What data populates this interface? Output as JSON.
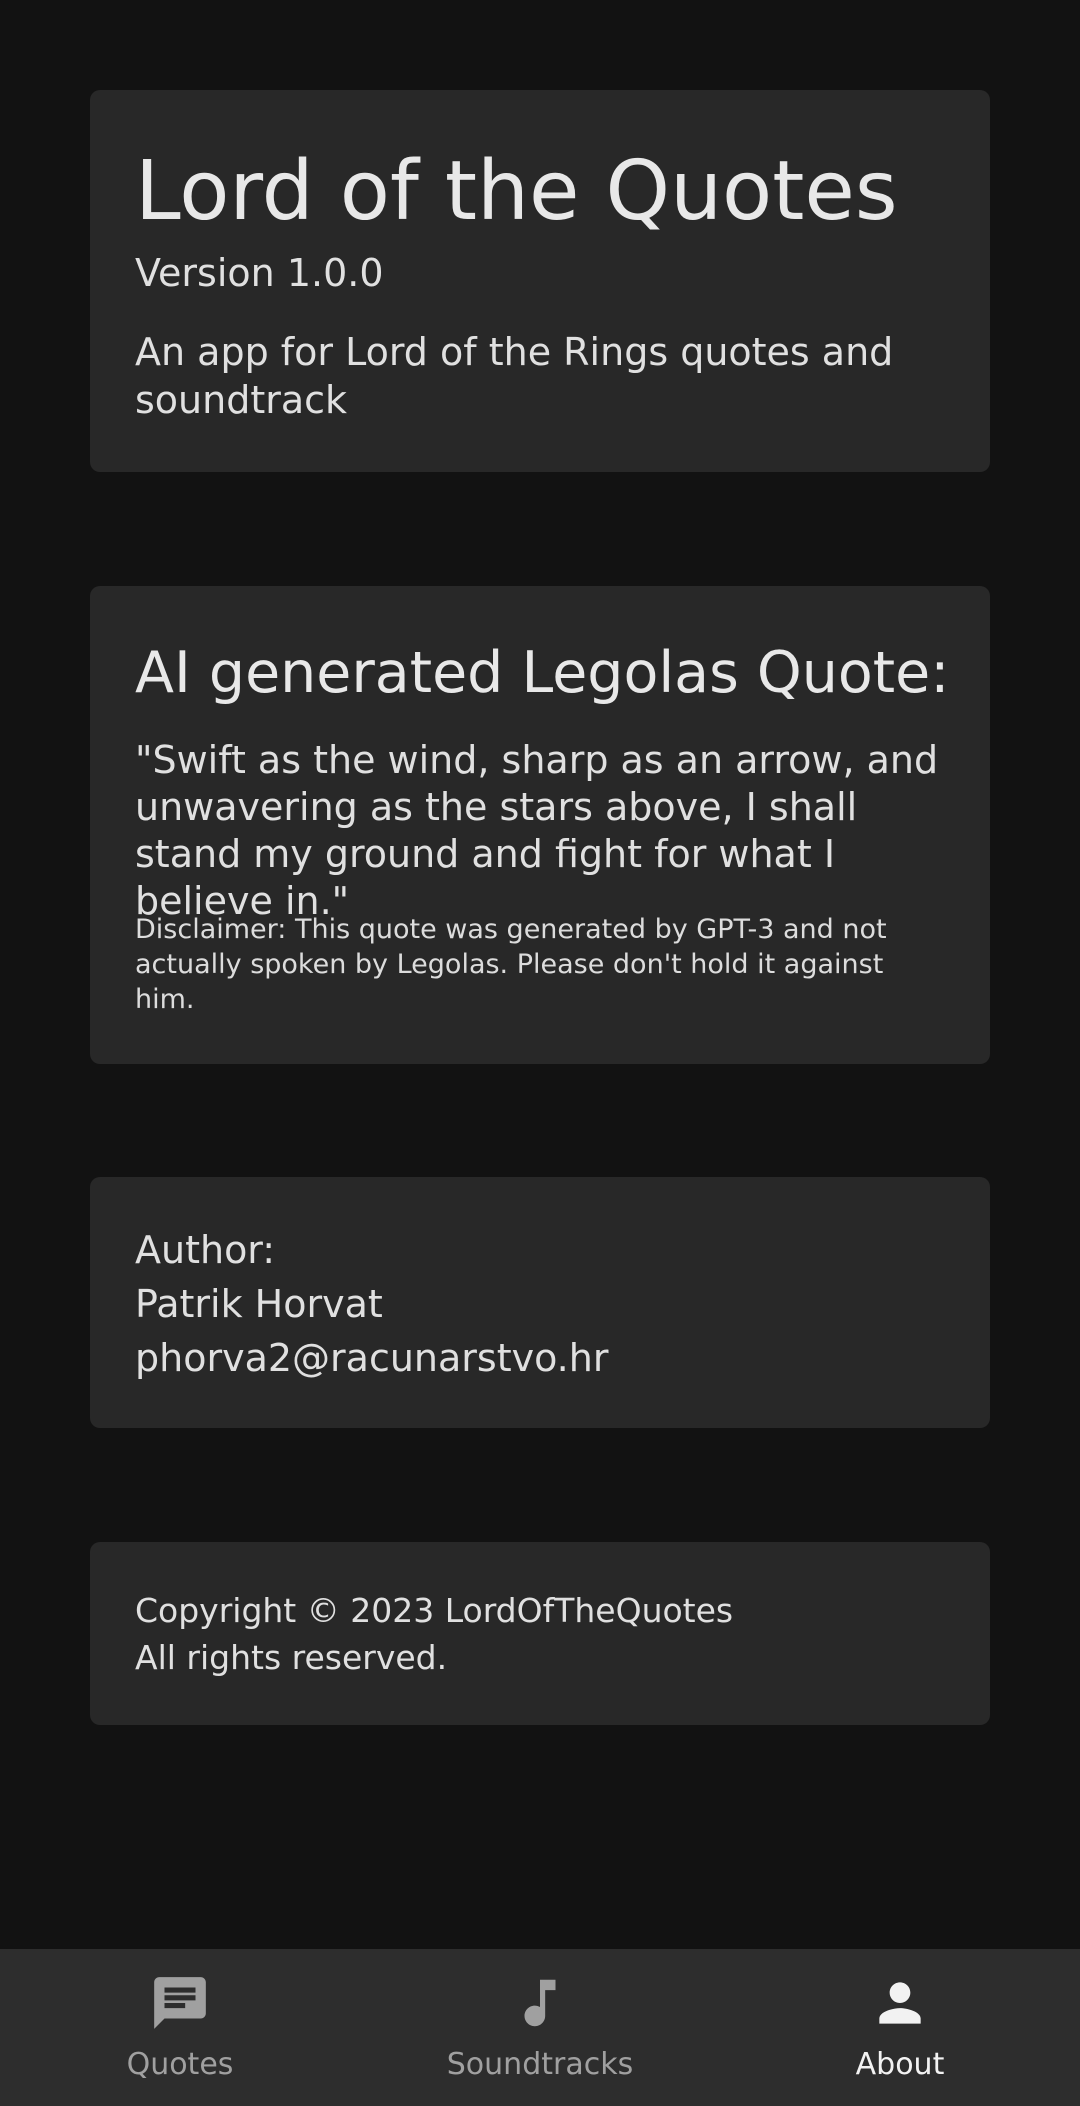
{
  "app_card": {
    "title": "Lord of the Quotes",
    "version": "Version 1.0.0",
    "description": "An app for Lord of the Rings quotes and soundtrack"
  },
  "quote_card": {
    "heading": "AI generated Legolas Quote:",
    "quote": "\"Swift as the wind, sharp as an arrow, and unwavering as the stars above, I shall stand my ground and fight for what I believe in.\"",
    "disclaimer": "Disclaimer: This quote was generated by GPT-3 and not actually spoken by Legolas. Please don't hold it against him."
  },
  "author_card": {
    "label": "Author:",
    "name": "Patrik Horvat",
    "email": "phorva2@racunarstvo.hr"
  },
  "copyright_card": {
    "line1": "Copyright © 2023 LordOfTheQuotes",
    "line2": "All rights reserved."
  },
  "bottom_nav": {
    "items": [
      {
        "label": "Quotes",
        "icon": "chat-bubble-icon",
        "active": false
      },
      {
        "label": "Soundtracks",
        "icon": "music-note-icon",
        "active": false
      },
      {
        "label": "About",
        "icon": "person-icon",
        "active": true
      }
    ]
  },
  "colors": {
    "background": "#121212",
    "card": "#282828",
    "nav_background": "#2d2d2d",
    "nav_inactive": "#a0a0a0",
    "nav_active": "#f2f2f2"
  }
}
